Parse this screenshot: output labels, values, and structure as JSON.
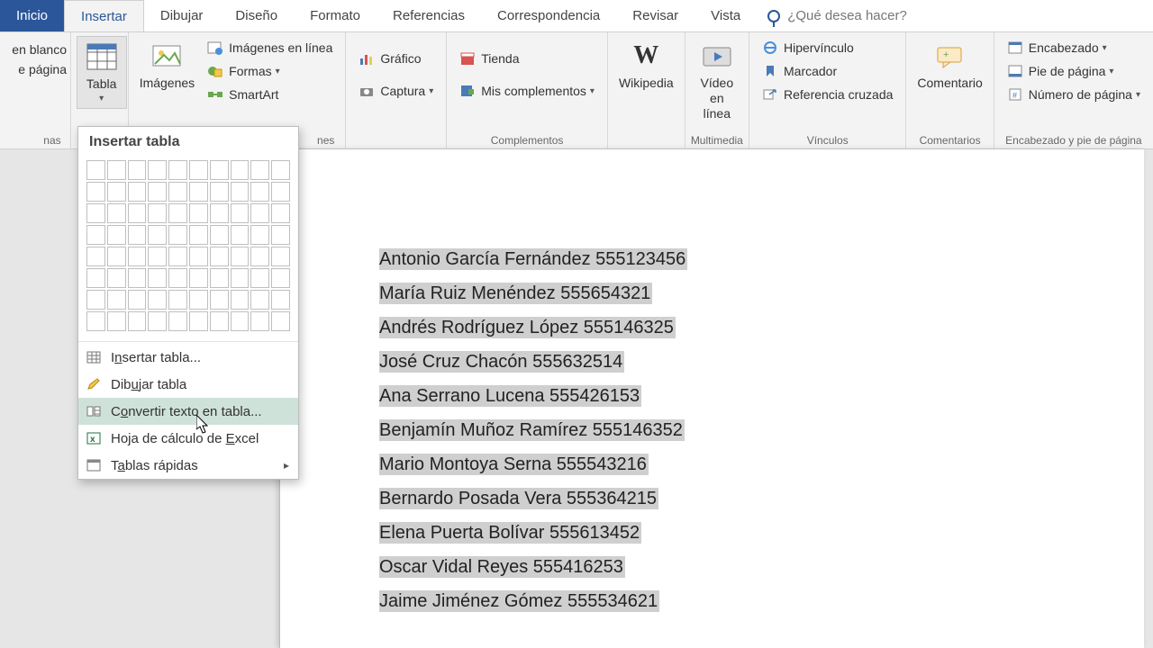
{
  "tabs": {
    "home": "Inicio",
    "insert": "Insertar",
    "draw": "Dibujar",
    "design": "Diseño",
    "layout": "Formato",
    "references": "Referencias",
    "mailings": "Correspondencia",
    "review": "Revisar",
    "view": "Vista",
    "tell_me": "¿Qué desea hacer?"
  },
  "leftcut": {
    "l1": "en blanco",
    "l2": "e página",
    "l3": "nas"
  },
  "ribbon": {
    "table": "Tabla",
    "images": "Imágenes",
    "online_images": "Imágenes en línea",
    "shapes": "Formas",
    "smartart": "SmartArt",
    "illustrations_group_cut": "nes",
    "chart": "Gráfico",
    "capture": "Captura",
    "store": "Tienda",
    "myaddins": "Mis complementos",
    "addins_group": "Complementos",
    "wikipedia": "Wikipedia",
    "online_video": "Vídeo en línea",
    "multimedia_group": "Multimedia",
    "hyperlink": "Hipervínculo",
    "bookmark": "Marcador",
    "crossref": "Referencia cruzada",
    "links_group": "Vínculos",
    "comment": "Comentario",
    "comments_group": "Comentarios",
    "header": "Encabezado",
    "footer": "Pie de página",
    "pagenum": "Número de página",
    "headerfooter_group": "Encabezado y pie de página"
  },
  "dropdown": {
    "title": "Insertar tabla",
    "insert_table_pre": "I",
    "insert_table_mid": "n",
    "insert_table_post": "sertar tabla...",
    "draw_table_pre": "Dib",
    "draw_table_mid": "u",
    "draw_table_post": "jar tabla",
    "convert_pre": "C",
    "convert_mid": "o",
    "convert_post": "nvertir texto en tabla...",
    "excel_pre": "Hoja de cálculo de ",
    "excel_mid": "E",
    "excel_post": "xcel",
    "quick_pre": "T",
    "quick_mid": "a",
    "quick_post": "blas rápidas"
  },
  "doc": {
    "lines": [
      "Antonio García Fernández 555123456",
      "María Ruiz Menéndez 555654321",
      "Andrés Rodríguez López 555146325",
      "José Cruz Chacón 555632514",
      "Ana Serrano Lucena 555426153",
      "Benjamín Muñoz Ramírez 555146352",
      "Mario Montoya Serna 555543216",
      "Bernardo Posada Vera 555364215",
      "Elena Puerta Bolívar 555613452",
      "Oscar Vidal Reyes 555416253",
      "Jaime Jiménez Gómez 555534621"
    ]
  }
}
